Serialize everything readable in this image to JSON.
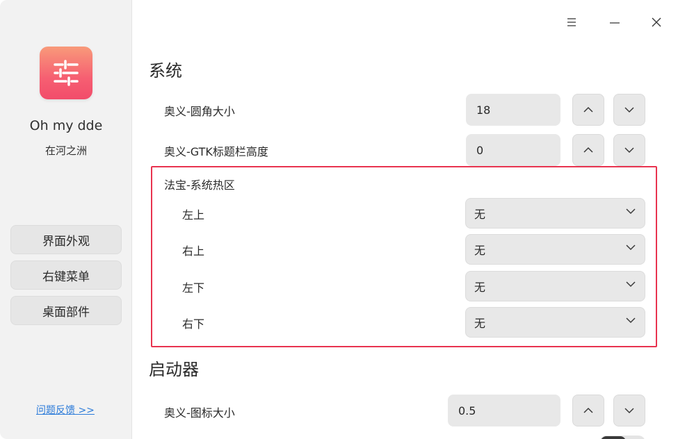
{
  "sidebar": {
    "app_icon": "sliders-icon",
    "app_name": "Oh my dde",
    "author": "在河之洲",
    "nav": [
      {
        "label": "界面外观"
      },
      {
        "label": "右键菜单"
      },
      {
        "label": "桌面部件"
      }
    ],
    "feedback": "问题反馈  >>"
  },
  "titlebar": {
    "menu_icon": "menu-icon",
    "minimize_icon": "minimize-icon",
    "close_icon": "close-icon"
  },
  "system": {
    "title": "系统",
    "corner_radius": {
      "label": "奥义-圆角大小",
      "value": "18"
    },
    "gtk_titlebar": {
      "label": "奥义-GTK标题栏高度",
      "value": "0"
    },
    "hot_corners": {
      "title": "法宝-系统热区",
      "items": [
        {
          "label": "左上",
          "value": "无"
        },
        {
          "label": "右上",
          "value": "无"
        },
        {
          "label": "左下",
          "value": "无"
        },
        {
          "label": "右下",
          "value": "无"
        }
      ]
    }
  },
  "launcher": {
    "title": "启动器",
    "icon_size": {
      "label": "奥义-图标大小",
      "value": "0.5"
    }
  },
  "colors": {
    "highlight": "#e8334f",
    "link": "#2a7ad9",
    "icon_gradient_top": "#f89a7a",
    "icon_gradient_bottom": "#f24c6a"
  }
}
